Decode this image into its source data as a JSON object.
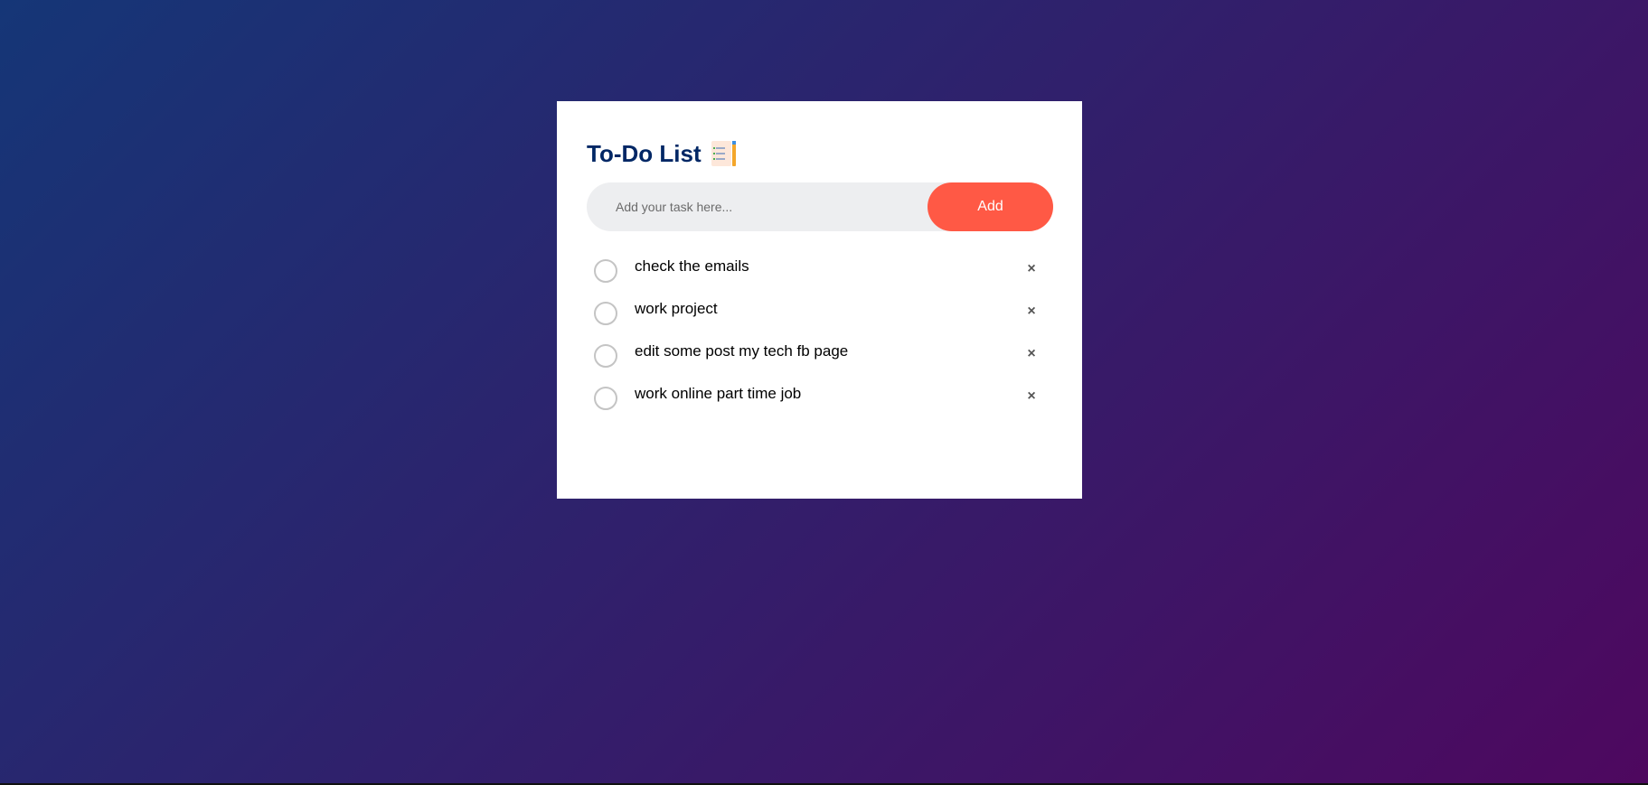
{
  "app": {
    "title": "To-Do List",
    "title_icon": "notepad-checklist-icon"
  },
  "input": {
    "placeholder": "Add your task here...",
    "value": "",
    "add_label": "Add"
  },
  "tasks": [
    {
      "label": "check the emails",
      "checked": false,
      "delete_icon": "×"
    },
    {
      "label": "work project",
      "checked": false,
      "delete_icon": "×"
    },
    {
      "label": "edit some post my tech fb page",
      "checked": false,
      "delete_icon": "×"
    },
    {
      "label": "work online part time job",
      "checked": false,
      "delete_icon": "×"
    }
  ],
  "colors": {
    "background_start": "#153677",
    "background_end": "#4e085f",
    "title": "#002765",
    "accent": "#ff5945",
    "input_bg": "#edeef0"
  }
}
